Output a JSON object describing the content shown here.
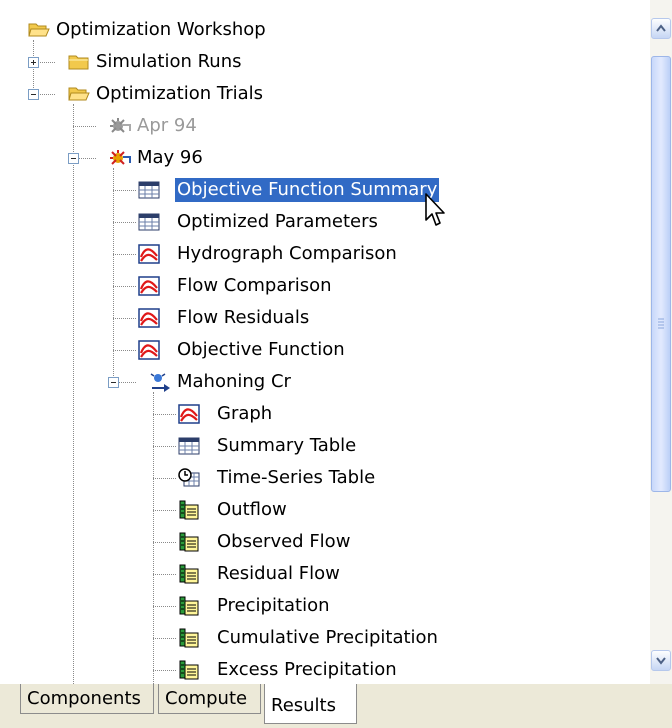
{
  "tree": {
    "root": {
      "label": "Optimization Workshop",
      "icon": "folder-open-icon"
    },
    "simulation_runs": {
      "label": "Simulation Runs",
      "icon": "folder-closed-icon"
    },
    "optimization_trials": {
      "label": "Optimization Trials",
      "icon": "folder-open-icon"
    },
    "trial_apr94": {
      "label": "Apr 94",
      "icon": "optimization-trial-inactive-icon"
    },
    "trial_may96": {
      "label": "May 96",
      "icon": "optimization-trial-active-icon"
    },
    "trial_items": [
      {
        "label": "Objective Function Summary",
        "icon": "table-icon",
        "selected": true
      },
      {
        "label": "Optimized Parameters",
        "icon": "table-icon"
      },
      {
        "label": "Hydrograph Comparison",
        "icon": "graph-icon"
      },
      {
        "label": "Flow Comparison",
        "icon": "graph-icon"
      },
      {
        "label": "Flow Residuals",
        "icon": "graph-icon"
      },
      {
        "label": "Objective Function",
        "icon": "graph-icon"
      }
    ],
    "element": {
      "label": "Mahoning Cr",
      "icon": "sink-element-icon"
    },
    "element_items": [
      {
        "label": "Graph",
        "icon": "graph-icon"
      },
      {
        "label": "Summary Table",
        "icon": "table-icon"
      },
      {
        "label": "Time-Series Table",
        "icon": "time-series-table-icon"
      },
      {
        "label": "Outflow",
        "icon": "time-series-icon"
      },
      {
        "label": "Observed Flow",
        "icon": "time-series-icon"
      },
      {
        "label": "Residual Flow",
        "icon": "time-series-icon"
      },
      {
        "label": "Precipitation",
        "icon": "time-series-icon"
      },
      {
        "label": "Cumulative Precipitation",
        "icon": "time-series-icon"
      },
      {
        "label": "Excess Precipitation",
        "icon": "time-series-icon"
      }
    ]
  },
  "tabs": [
    {
      "label": "Components",
      "active": false
    },
    {
      "label": "Compute",
      "active": false
    },
    {
      "label": "Results",
      "active": true
    }
  ],
  "colors": {
    "selection": "#316ac5",
    "folder": "#f2c94c",
    "graph_red": "#e01818",
    "tab_bar": "#ece9d8"
  }
}
